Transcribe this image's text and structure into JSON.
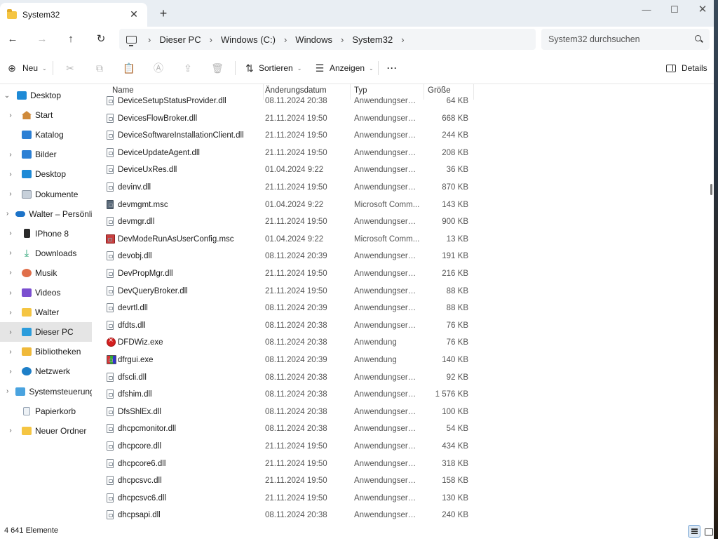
{
  "window": {
    "tab_title": "System32",
    "tab_close": "✕",
    "new_tab": "+",
    "minimize": "—",
    "maximize": "☐",
    "close": "✕"
  },
  "address": {
    "back": "←",
    "forward": "→",
    "up": "↑",
    "refresh": "↻",
    "crumbs": [
      "Dieser PC",
      "Windows (C:)",
      "Windows",
      "System32"
    ],
    "separator": "›",
    "search_placeholder": "System32 durchsuchen"
  },
  "toolbar": {
    "new_label": "Neu",
    "sort_label": "Sortieren",
    "view_label": "Anzeigen",
    "more_label": "···",
    "details_label": "Details",
    "new_icon": "⊕",
    "cut_icon": "✂",
    "copy_icon": "⧉",
    "paste_icon": "📋",
    "rename_icon": "Ⓐ",
    "share_icon": "⇪",
    "delete_icon": "🗑",
    "sort_icon": "⇅",
    "view_icon": "☰",
    "caret": "⌄"
  },
  "sidebar": {
    "items": [
      {
        "label": "Desktop",
        "chevron": "⌄",
        "icon": "desktop-icon"
      },
      {
        "label": "Start",
        "chevron": "›",
        "icon": "home-icon"
      },
      {
        "label": "Katalog",
        "chevron": "",
        "icon": "gallery-icon"
      },
      {
        "label": "Bilder",
        "chevron": "›",
        "icon": "pictures-icon"
      },
      {
        "label": "Desktop",
        "chevron": "›",
        "icon": "desktop-icon"
      },
      {
        "label": "Dokumente",
        "chevron": "›",
        "icon": "documents-icon"
      },
      {
        "label": "Walter – Persönlic",
        "chevron": "›",
        "icon": "onedrive-icon"
      },
      {
        "label": "IPhone 8",
        "chevron": "›",
        "icon": "phone-icon"
      },
      {
        "label": "Downloads",
        "chevron": "›",
        "icon": "downloads-icon"
      },
      {
        "label": "Musik",
        "chevron": "›",
        "icon": "music-icon"
      },
      {
        "label": "Videos",
        "chevron": "›",
        "icon": "videos-icon"
      },
      {
        "label": "Walter",
        "chevron": "›",
        "icon": "folder-icon"
      },
      {
        "label": "Dieser PC",
        "chevron": "›",
        "icon": "this-pc-icon",
        "selected": true
      },
      {
        "label": "Bibliotheken",
        "chevron": "›",
        "icon": "libraries-icon"
      },
      {
        "label": "Netzwerk",
        "chevron": "›",
        "icon": "network-icon"
      },
      {
        "label": "Systemsteuerung",
        "chevron": "›",
        "icon": "control-panel-icon"
      },
      {
        "label": "Papierkorb",
        "chevron": "",
        "icon": "recycle-bin-icon"
      },
      {
        "label": "Neuer Ordner",
        "chevron": "›",
        "icon": "folder-icon"
      }
    ]
  },
  "columns": {
    "name": "Name",
    "date": "Änderungsdatum",
    "type": "Typ",
    "size": "Größe",
    "sort_arrow": "⌃"
  },
  "files": [
    {
      "name": "DeviceSetupStatusProvider.dll",
      "date": "08.11.2024 20:38",
      "type": "Anwendungserwe...",
      "size": "64 KB",
      "icon": "dll"
    },
    {
      "name": "DevicesFlowBroker.dll",
      "date": "21.11.2024 19:50",
      "type": "Anwendungserwe...",
      "size": "668 KB",
      "icon": "dll"
    },
    {
      "name": "DeviceSoftwareInstallationClient.dll",
      "date": "21.11.2024 19:50",
      "type": "Anwendungserwe...",
      "size": "244 KB",
      "icon": "dll"
    },
    {
      "name": "DeviceUpdateAgent.dll",
      "date": "21.11.2024 19:50",
      "type": "Anwendungserwe...",
      "size": "208 KB",
      "icon": "dll"
    },
    {
      "name": "DeviceUxRes.dll",
      "date": "01.04.2024 9:22",
      "type": "Anwendungserwe...",
      "size": "36 KB",
      "icon": "dll"
    },
    {
      "name": "devinv.dll",
      "date": "21.11.2024 19:50",
      "type": "Anwendungserwe...",
      "size": "870 KB",
      "icon": "dll"
    },
    {
      "name": "devmgmt.msc",
      "date": "01.04.2024 9:22",
      "type": "Microsoft Comm...",
      "size": "143 KB",
      "icon": "msc"
    },
    {
      "name": "devmgr.dll",
      "date": "21.11.2024 19:50",
      "type": "Anwendungserwe...",
      "size": "900 KB",
      "icon": "dll"
    },
    {
      "name": "DevModeRunAsUserConfig.msc",
      "date": "01.04.2024 9:22",
      "type": "Microsoft Comm...",
      "size": "13 KB",
      "icon": "msc-red"
    },
    {
      "name": "devobj.dll",
      "date": "08.11.2024 20:39",
      "type": "Anwendungserwe...",
      "size": "191 KB",
      "icon": "dll"
    },
    {
      "name": "DevPropMgr.dll",
      "date": "21.11.2024 19:50",
      "type": "Anwendungserwe...",
      "size": "216 KB",
      "icon": "dll"
    },
    {
      "name": "DevQueryBroker.dll",
      "date": "21.11.2024 19:50",
      "type": "Anwendungserwe...",
      "size": "88 KB",
      "icon": "dll"
    },
    {
      "name": "devrtl.dll",
      "date": "08.11.2024 20:39",
      "type": "Anwendungserwe...",
      "size": "88 KB",
      "icon": "dll"
    },
    {
      "name": "dfdts.dll",
      "date": "08.11.2024 20:38",
      "type": "Anwendungserwe...",
      "size": "76 KB",
      "icon": "dll"
    },
    {
      "name": "DFDWiz.exe",
      "date": "08.11.2024 20:38",
      "type": "Anwendung",
      "size": "76 KB",
      "icon": "err"
    },
    {
      "name": "dfrgui.exe",
      "date": "08.11.2024 20:39",
      "type": "Anwendung",
      "size": "140 KB",
      "icon": "dfrg"
    },
    {
      "name": "dfscli.dll",
      "date": "08.11.2024 20:38",
      "type": "Anwendungserwe...",
      "size": "92 KB",
      "icon": "dll"
    },
    {
      "name": "dfshim.dll",
      "date": "08.11.2024 20:38",
      "type": "Anwendungserwe...",
      "size": "1 576 KB",
      "icon": "dll"
    },
    {
      "name": "DfsShlEx.dll",
      "date": "08.11.2024 20:38",
      "type": "Anwendungserwe...",
      "size": "100 KB",
      "icon": "dll"
    },
    {
      "name": "dhcpcmonitor.dll",
      "date": "08.11.2024 20:38",
      "type": "Anwendungserwe...",
      "size": "54 KB",
      "icon": "dll"
    },
    {
      "name": "dhcpcore.dll",
      "date": "21.11.2024 19:50",
      "type": "Anwendungserwe...",
      "size": "434 KB",
      "icon": "dll"
    },
    {
      "name": "dhcpcore6.dll",
      "date": "21.11.2024 19:50",
      "type": "Anwendungserwe...",
      "size": "318 KB",
      "icon": "dll"
    },
    {
      "name": "dhcpcsvc.dll",
      "date": "21.11.2024 19:50",
      "type": "Anwendungserwe...",
      "size": "158 KB",
      "icon": "dll"
    },
    {
      "name": "dhcpcsvc6.dll",
      "date": "21.11.2024 19:50",
      "type": "Anwendungserwe...",
      "size": "130 KB",
      "icon": "dll"
    },
    {
      "name": "dhcpsapi.dll",
      "date": "08.11.2024 20:38",
      "type": "Anwendungserwe...",
      "size": "240 KB",
      "icon": "dll"
    }
  ],
  "status": {
    "count": "4 641 Elemente"
  }
}
